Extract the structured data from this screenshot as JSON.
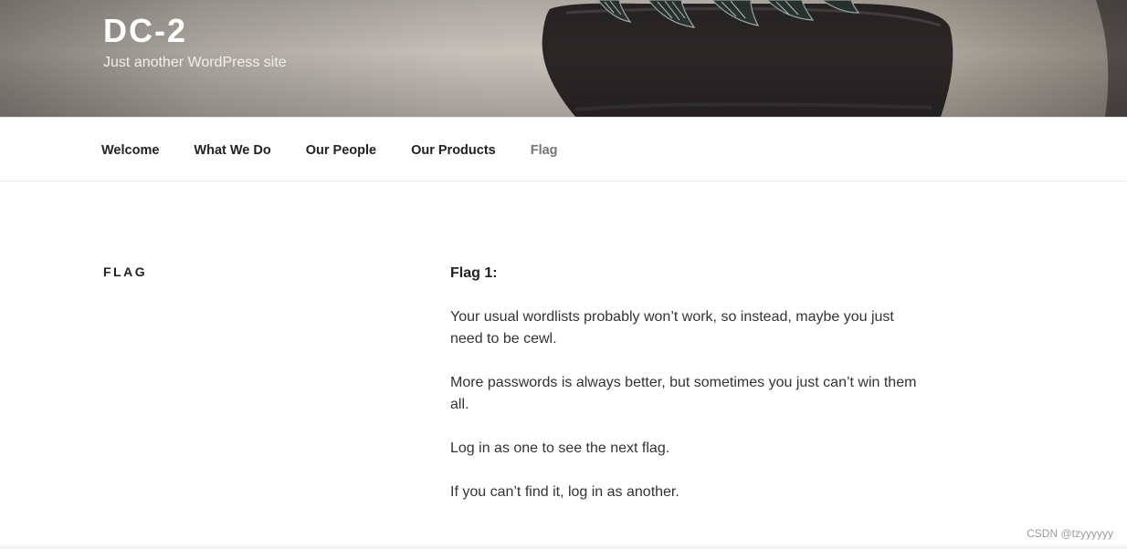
{
  "site": {
    "title": "DC-2",
    "tagline": "Just another WordPress site"
  },
  "nav": {
    "items": [
      {
        "label": "Welcome"
      },
      {
        "label": "What We Do"
      },
      {
        "label": "Our People"
      },
      {
        "label": "Our Products"
      },
      {
        "label": "Flag",
        "current": true
      }
    ]
  },
  "page": {
    "heading": "FLAG",
    "flag_label": "Flag 1:",
    "paragraphs": [
      "Your usual wordlists probably won’t work, so instead, maybe you just need to be cewl.",
      "More passwords is always better, but sometimes you just can’t win them all.",
      "Log in as one to see the next flag.",
      "If you can’t find it, log in as another."
    ]
  },
  "watermark": "CSDN @tzyyyyyy",
  "colors": {
    "nav_text": "#222222",
    "nav_current": "#767676",
    "body_text": "#333333"
  }
}
